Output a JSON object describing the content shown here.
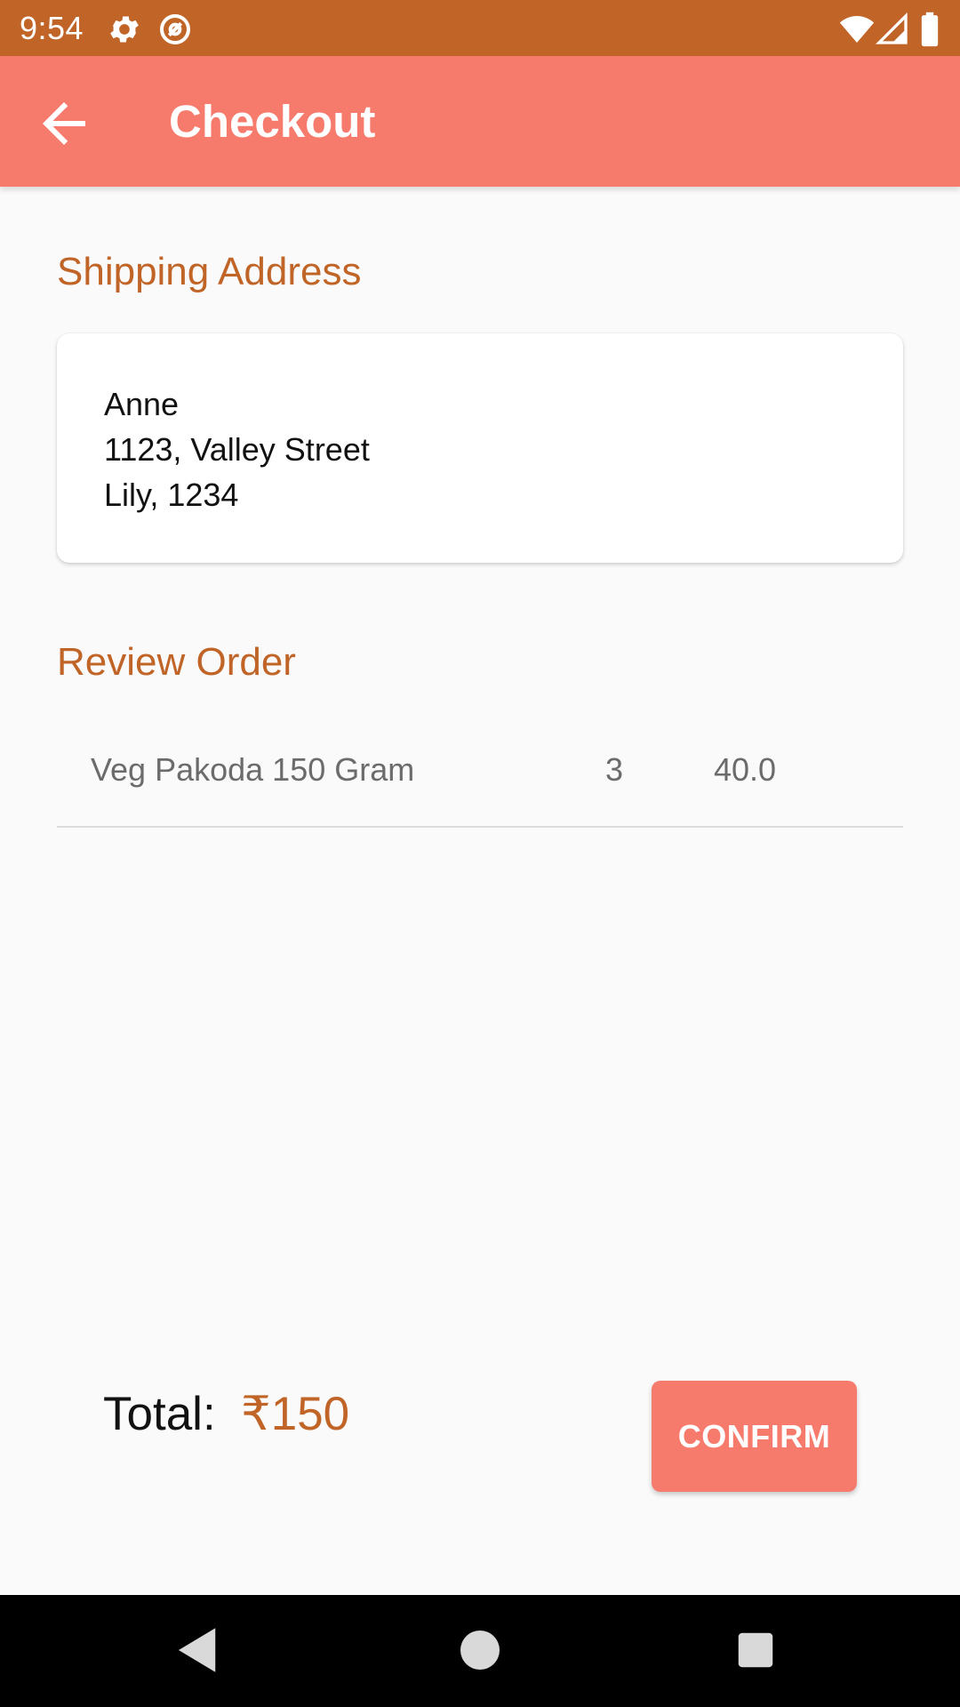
{
  "status_bar": {
    "time": "9:54",
    "icons": [
      "settings-icon",
      "at-sign-icon",
      "wifi-icon",
      "signal-icon",
      "battery-icon"
    ],
    "background": "#c06527"
  },
  "app_bar": {
    "title": "Checkout",
    "back_icon": "arrow-back-icon",
    "background": "#f77b6c"
  },
  "shipping": {
    "title": "Shipping Address",
    "name": "Anne",
    "street": "1123, Valley Street",
    "city_line": "Lily, 1234"
  },
  "review": {
    "title": "Review Order",
    "items": [
      {
        "name": "Veg Pakoda 150 Gram",
        "quantity": "3",
        "price": "40.0"
      }
    ]
  },
  "total": {
    "label": "Total:",
    "value": "₹150"
  },
  "actions": {
    "confirm_label": "CONFIRM"
  },
  "nav_bar": {
    "icons": [
      "back-triangle-icon",
      "home-circle-icon",
      "recents-square-icon"
    ]
  },
  "colors": {
    "accent": "#c06527",
    "primary": "#f77b6c",
    "background": "#fafafa"
  }
}
